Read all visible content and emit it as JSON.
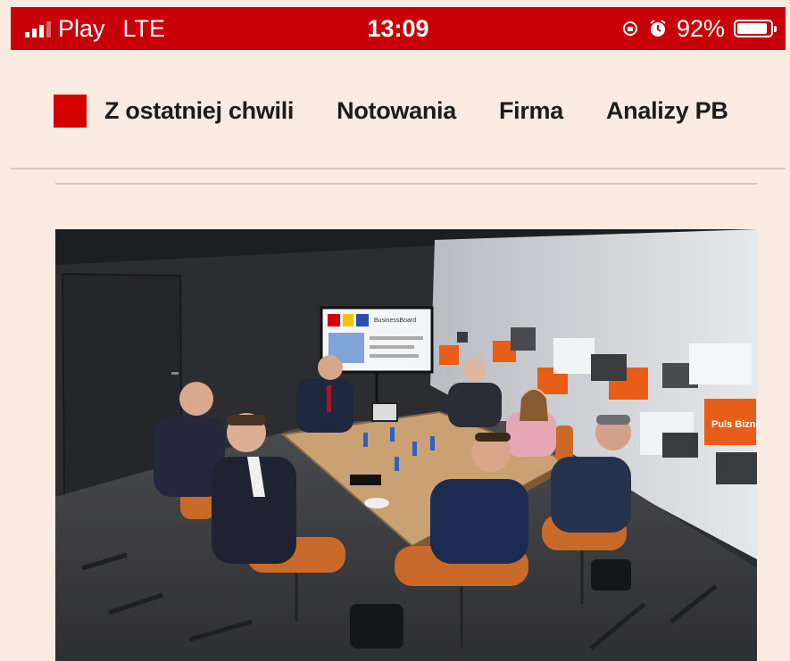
{
  "status_bar": {
    "carrier": "Play",
    "network": "LTE",
    "time": "13:09",
    "battery_percent": "92%",
    "battery_level": 0.92,
    "icons": [
      "signal-icon",
      "rotation-lock-icon",
      "alarm-icon",
      "battery-icon"
    ]
  },
  "nav": {
    "items": [
      "Z ostatniej chwili",
      "Notowania",
      "Firma",
      "Analizy PB"
    ]
  },
  "colors": {
    "status_bar_bg": "#c8000a",
    "brand_red": "#d50000",
    "page_bg": "#f9ebe1"
  },
  "article": {
    "photo": {
      "screen_slide_text": "BusinessBoard",
      "wall_logo_text": "Puls Biznesu"
    }
  }
}
